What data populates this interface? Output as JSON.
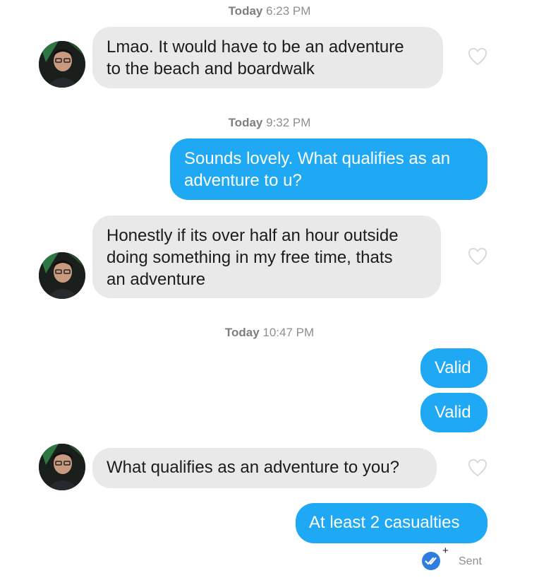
{
  "messages": [
    {
      "type": "timestamp",
      "day": "Today",
      "time": "6:23 PM"
    },
    {
      "type": "incoming",
      "lines": [
        "Lmao. It would have to be an adventure",
        "to the beach and boardwalk"
      ]
    },
    {
      "type": "timestamp",
      "day": "Today",
      "time": "9:32 PM"
    },
    {
      "type": "outgoing",
      "lines": [
        "Sounds lovely. What qualifies as an",
        "adventure to u?"
      ]
    },
    {
      "type": "incoming",
      "lines": [
        "Honestly if its over half an hour outside",
        "doing something in my free time, thats",
        "an adventure"
      ]
    },
    {
      "type": "timestamp",
      "day": "Today",
      "time": "10:47 PM"
    },
    {
      "type": "outgoing",
      "lines": [
        "Valid"
      ]
    },
    {
      "type": "outgoing",
      "lines": [
        "Valid"
      ]
    },
    {
      "type": "incoming",
      "lines": [
        "What qualifies as an adventure to you?"
      ]
    },
    {
      "type": "outgoing",
      "lines": [
        "At least 2 casualties"
      ]
    }
  ],
  "status": {
    "label": "Sent",
    "badge_plus": "+"
  },
  "colors": {
    "outgoing_bubble": "#1fa9f5",
    "incoming_bubble": "#e9e9ea",
    "timestamp": "#8e8e93",
    "receipt_badge": "#2f7de1"
  },
  "icons": {
    "like": "heart-outline-icon",
    "avatar": "contact-avatar",
    "read_receipt": "double-check-icon"
  }
}
